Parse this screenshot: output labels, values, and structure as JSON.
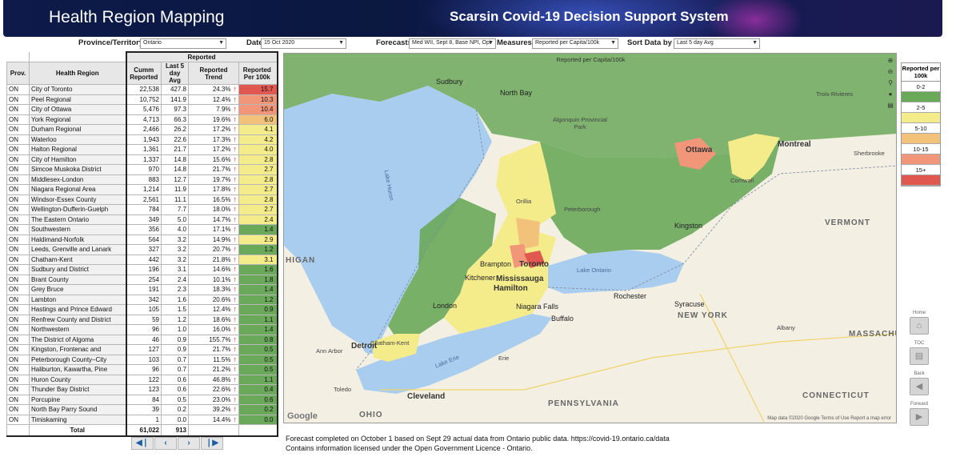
{
  "header": {
    "app_title": "Health Region Mapping",
    "system_title": "Scarsin Covid-19 Decision Support System"
  },
  "controls": {
    "province_label": "Province/Territory",
    "province_value": "Ontario",
    "date_label": "Date",
    "date_value": "15 Oct 2020",
    "forecasts_label": "Forecasts",
    "forecasts_value": "Med WII, Sept 8, Base NPI, Opt",
    "measures_label": "Measures",
    "measures_value": "Reported per Capita/100k",
    "sort_label": "Sort Data by",
    "sort_value": "Last 5 day Avg"
  },
  "table": {
    "group_header": "Reported",
    "headers": {
      "prov": "Prov.",
      "region": "Health Region",
      "cumm": "Cumm Reported",
      "last5": "Last 5 day Avg",
      "trend": "Reported Trend",
      "per100k": "Reported Per 100k"
    },
    "rows": [
      {
        "prov": "ON",
        "region": "City of Toronto",
        "cumm": "22,538",
        "last5": "427.8",
        "trend": "24.3%",
        "per100k": "15.7",
        "color": "#e0584f"
      },
      {
        "prov": "ON",
        "region": "Peel Regional",
        "cumm": "10,752",
        "last5": "141.9",
        "trend": "12.4%",
        "per100k": "10.3",
        "color": "#f2967a"
      },
      {
        "prov": "ON",
        "region": "City of Ottawa",
        "cumm": "5,476",
        "last5": "97.3",
        "trend": "7.9%",
        "per100k": "10.4",
        "color": "#f2967a"
      },
      {
        "prov": "ON",
        "region": "York Regional",
        "cumm": "4,713",
        "last5": "66.3",
        "trend": "19.6%",
        "per100k": "6.0",
        "color": "#f2c27a"
      },
      {
        "prov": "ON",
        "region": "Durham Regional",
        "cumm": "2,466",
        "last5": "26.2",
        "trend": "17.2%",
        "per100k": "4.1",
        "color": "#f4ec8a"
      },
      {
        "prov": "ON",
        "region": "Waterloo",
        "cumm": "1,943",
        "last5": "22.6",
        "trend": "17.3%",
        "per100k": "4.2",
        "color": "#f4ec8a"
      },
      {
        "prov": "ON",
        "region": "Halton Regional",
        "cumm": "1,361",
        "last5": "21.7",
        "trend": "17.2%",
        "per100k": "4.0",
        "color": "#f4ec8a"
      },
      {
        "prov": "ON",
        "region": "City of Hamilton",
        "cumm": "1,337",
        "last5": "14.8",
        "trend": "15.6%",
        "per100k": "2.8",
        "color": "#f4ec8a"
      },
      {
        "prov": "ON",
        "region": "Simcoe Muskoka District",
        "cumm": "970",
        "last5": "14.8",
        "trend": "21.7%",
        "per100k": "2.7",
        "color": "#f4ec8a"
      },
      {
        "prov": "ON",
        "region": "Middlesex-London",
        "cumm": "883",
        "last5": "12.7",
        "trend": "19.7%",
        "per100k": "2.8",
        "color": "#f4ec8a"
      },
      {
        "prov": "ON",
        "region": "Niagara Regional Area",
        "cumm": "1,214",
        "last5": "11.9",
        "trend": "17.8%",
        "per100k": "2.7",
        "color": "#f4ec8a"
      },
      {
        "prov": "ON",
        "region": "Windsor-Essex County",
        "cumm": "2,561",
        "last5": "11.1",
        "trend": "16.5%",
        "per100k": "2.8",
        "color": "#f4ec8a"
      },
      {
        "prov": "ON",
        "region": "Wellington-Dufferin-Guelph",
        "cumm": "784",
        "last5": "7.7",
        "trend": "18.0%",
        "per100k": "2.7",
        "color": "#f4ec8a"
      },
      {
        "prov": "ON",
        "region": "The Eastern Ontario",
        "cumm": "349",
        "last5": "5.0",
        "trend": "14.7%",
        "per100k": "2.4",
        "color": "#f4ec8a"
      },
      {
        "prov": "ON",
        "region": "Southwestern",
        "cumm": "356",
        "last5": "4.0",
        "trend": "17.1%",
        "per100k": "1.4",
        "color": "#6aa85a"
      },
      {
        "prov": "ON",
        "region": "Haldimand-Norfolk",
        "cumm": "564",
        "last5": "3.2",
        "trend": "14.9%",
        "per100k": "2.9",
        "color": "#f4ec8a"
      },
      {
        "prov": "ON",
        "region": "Leeds, Grenville and Lanark",
        "cumm": "327",
        "last5": "3.2",
        "trend": "20.7%",
        "per100k": "1.2",
        "color": "#6aa85a"
      },
      {
        "prov": "ON",
        "region": "Chatham-Kent",
        "cumm": "442",
        "last5": "3.2",
        "trend": "21.8%",
        "per100k": "3.1",
        "color": "#f4ec8a"
      },
      {
        "prov": "ON",
        "region": "Sudbury and District",
        "cumm": "196",
        "last5": "3.1",
        "trend": "14.6%",
        "per100k": "1.6",
        "color": "#6aa85a"
      },
      {
        "prov": "ON",
        "region": "Brant County",
        "cumm": "254",
        "last5": "2.4",
        "trend": "10.1%",
        "per100k": "1.8",
        "color": "#6aa85a"
      },
      {
        "prov": "ON",
        "region": "Grey Bruce",
        "cumm": "191",
        "last5": "2.3",
        "trend": "18.3%",
        "per100k": "1.4",
        "color": "#6aa85a"
      },
      {
        "prov": "ON",
        "region": "Lambton",
        "cumm": "342",
        "last5": "1.6",
        "trend": "20.6%",
        "per100k": "1.2",
        "color": "#6aa85a"
      },
      {
        "prov": "ON",
        "region": "Hastings and Prince Edward",
        "cumm": "105",
        "last5": "1.5",
        "trend": "12.4%",
        "per100k": "0.9",
        "color": "#6aa85a"
      },
      {
        "prov": "ON",
        "region": "Renfrew County and District",
        "cumm": "59",
        "last5": "1.2",
        "trend": "18.6%",
        "per100k": "1.1",
        "color": "#6aa85a"
      },
      {
        "prov": "ON",
        "region": "Northwestern",
        "cumm": "96",
        "last5": "1.0",
        "trend": "16.0%",
        "per100k": "1.4",
        "color": "#6aa85a"
      },
      {
        "prov": "ON",
        "region": "The District of Algoma",
        "cumm": "46",
        "last5": "0.9",
        "trend": "155.7%",
        "per100k": "0.8",
        "color": "#6aa85a"
      },
      {
        "prov": "ON",
        "region": "Kingston, Frontenac and",
        "cumm": "127",
        "last5": "0.9",
        "trend": "21.7%",
        "per100k": "0.5",
        "color": "#6aa85a"
      },
      {
        "prov": "ON",
        "region": "Peterborough County–City",
        "cumm": "103",
        "last5": "0.7",
        "trend": "11.5%",
        "per100k": "0.5",
        "color": "#6aa85a"
      },
      {
        "prov": "ON",
        "region": "Haliburton, Kawartha, Pine",
        "cumm": "96",
        "last5": "0.7",
        "trend": "21.2%",
        "per100k": "0.5",
        "color": "#6aa85a"
      },
      {
        "prov": "ON",
        "region": "Huron County",
        "cumm": "122",
        "last5": "0.6",
        "trend": "46.8%",
        "per100k": "1.1",
        "color": "#6aa85a"
      },
      {
        "prov": "ON",
        "region": "Thunder Bay District",
        "cumm": "123",
        "last5": "0.6",
        "trend": "22.6%",
        "per100k": "0.4",
        "color": "#6aa85a"
      },
      {
        "prov": "ON",
        "region": "Porcupine",
        "cumm": "84",
        "last5": "0.5",
        "trend": "23.0%",
        "per100k": "0.6",
        "color": "#6aa85a"
      },
      {
        "prov": "ON",
        "region": "North Bay Parry Sound",
        "cumm": "39",
        "last5": "0.2",
        "trend": "39.2%",
        "per100k": "0.2",
        "color": "#6aa85a"
      },
      {
        "prov": "ON",
        "region": "Timiskaming",
        "cumm": "1",
        "last5": "0.0",
        "trend": "14.4%",
        "per100k": "0.0",
        "color": "#6aa85a"
      }
    ],
    "total": {
      "label": "Total",
      "cumm": "61,022",
      "last5": "913"
    }
  },
  "pager": {
    "first": "K",
    "prev": "<",
    "next": ">",
    "last": "K"
  },
  "map": {
    "title": "Reported per Capita/100k",
    "labels": {
      "sudbury": "Sudbury",
      "north_bay": "North Bay",
      "algonquin": "Algonquin Provincial Park",
      "ottawa": "Ottawa",
      "montreal": "Montreal",
      "kingston": "Kingston",
      "peterborough": "Peterborough",
      "orillia": "Orillia",
      "brampton": "Brampton",
      "toronto": "Toronto",
      "mississauga": "Mississauga",
      "hamilton": "Hamilton",
      "kitchener": "Kitchener",
      "london": "London",
      "niagara": "Niagara Falls",
      "buffalo": "Buffalo",
      "rochester": "Rochester",
      "syracuse": "Syracuse",
      "detroit": "Detroit",
      "cleveland": "Cleveland",
      "toledo": "Toledo",
      "ann_arbor": "Ann Arbor",
      "chatham": "Chatham-Kent",
      "new_york": "NEW YORK",
      "vermont": "VERMONT",
      "massachu": "MASSACHU",
      "pennsylvania": "PENNSYLVANIA",
      "connecticut": "CONNECTICUT",
      "ohio": "OHIO",
      "michigan": "HIGAN",
      "lake_huron": "Lake Huron",
      "lake_ontario": "Lake Ontario",
      "lake_erie": "Lake Erie",
      "trois_rivieres": "Trois-Rivieres",
      "sherbrooke": "Sherbrooke",
      "albany": "Albany",
      "erie": "Erie",
      "cornwall": "Cornwall",
      "footer": "Map data ©2020 Google   Terms of Use   Report a map error",
      "google": "Google"
    }
  },
  "legend": {
    "title": "Reported per 100k",
    "items": [
      {
        "label": "0-2",
        "color": "#6aa85a"
      },
      {
        "label": "2-5",
        "color": "#f4ec8a"
      },
      {
        "label": "5-10",
        "color": "#f2c27a"
      },
      {
        "label": "10-15",
        "color": "#f2967a"
      },
      {
        "label": "15+",
        "color": "#e0584f"
      }
    ]
  },
  "side_nav": {
    "home": "Home",
    "toc": "TOC",
    "back": "Back",
    "forward": "Forward"
  },
  "footnote": {
    "line1": "Forecast completed on October 1 based on Sept 29 actual data from Ontario public data. https://covid-19.ontario.ca/data",
    "line2": "Contains information licensed under the Open Government Licence - Ontario."
  }
}
